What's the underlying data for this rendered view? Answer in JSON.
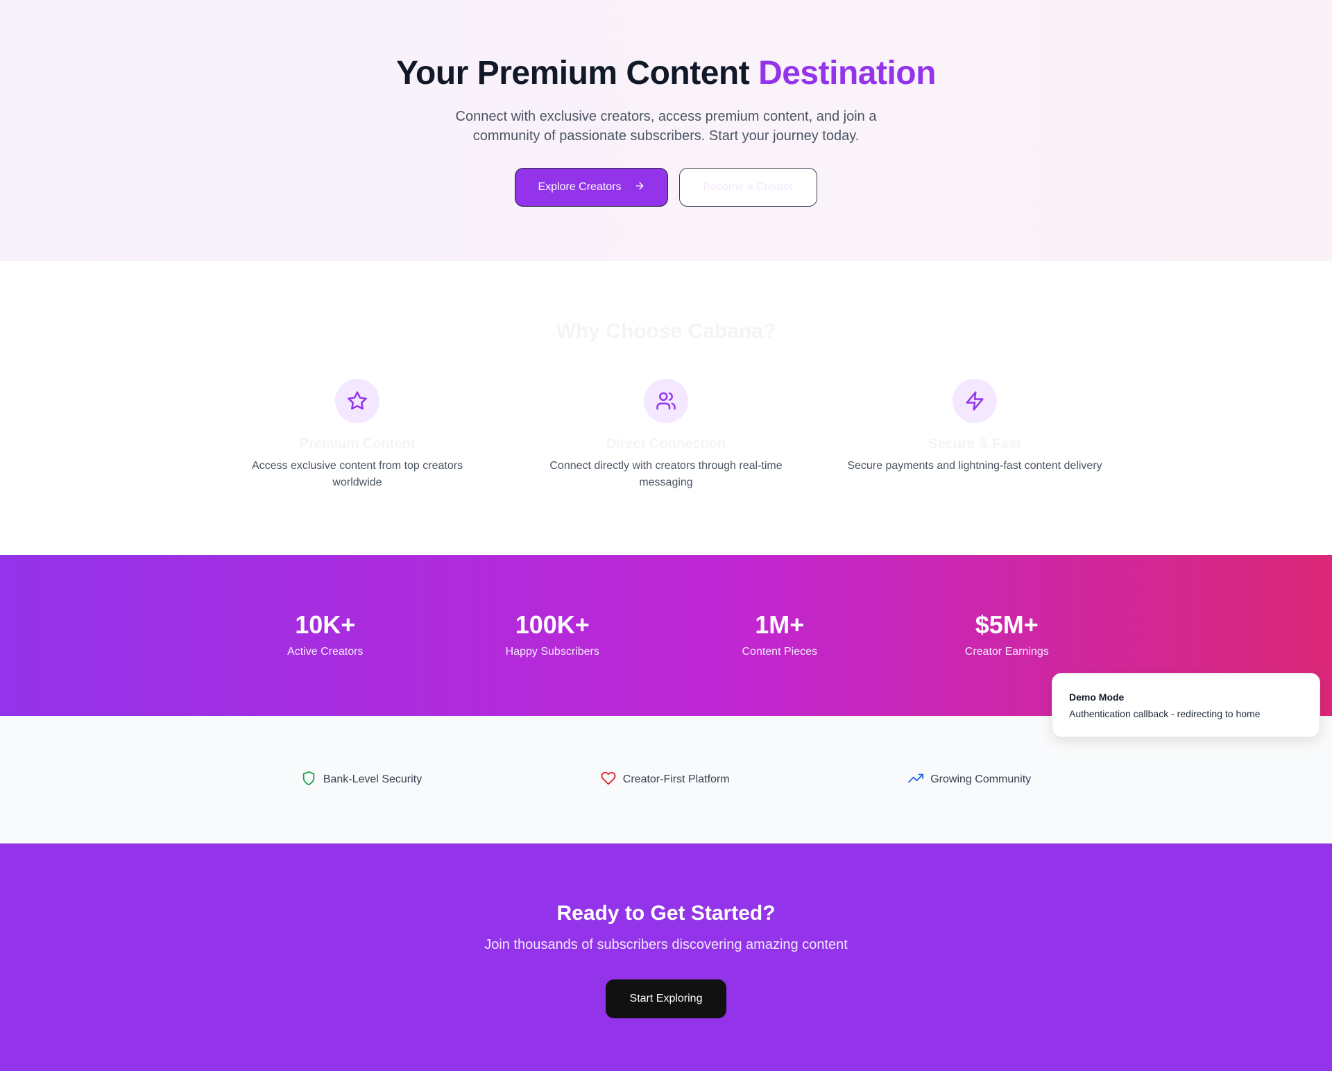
{
  "hero": {
    "title_main": "Your Premium Content ",
    "title_accent": "Destination",
    "subtitle": "Connect with exclusive creators, access premium content, and join a community of passionate subscribers. Start your journey today.",
    "primary_button": "Explore Creators",
    "secondary_button": "Become a Creator"
  },
  "features": {
    "heading": "Why Choose Cabana?",
    "items": [
      {
        "icon": "star-icon",
        "title": "Premium Content",
        "description": "Access exclusive content from top creators worldwide"
      },
      {
        "icon": "users-icon",
        "title": "Direct Connection",
        "description": "Connect directly with creators through real-time messaging"
      },
      {
        "icon": "lightning-icon",
        "title": "Secure & Fast",
        "description": "Secure payments and lightning-fast content delivery"
      }
    ]
  },
  "stats": [
    {
      "value": "10K+",
      "label": "Active Creators"
    },
    {
      "value": "100K+",
      "label": "Happy Subscribers"
    },
    {
      "value": "1M+",
      "label": "Content Pieces"
    },
    {
      "value": "$5M+",
      "label": "Creator Earnings"
    }
  ],
  "trust": [
    {
      "icon": "shield-icon",
      "label": "Bank-Level Security",
      "color": "#16a34a"
    },
    {
      "icon": "heart-icon",
      "label": "Creator-First Platform",
      "color": "#dc2626"
    },
    {
      "icon": "trending-up-icon",
      "label": "Growing Community",
      "color": "#2563eb"
    }
  ],
  "cta": {
    "heading": "Ready to Get Started?",
    "subtitle": "Join thousands of subscribers discovering amazing content",
    "button": "Start Exploring"
  },
  "toast": {
    "title": "Demo Mode",
    "description": "Authentication callback - redirecting to home"
  },
  "colors": {
    "accent": "#9333ea",
    "gradient_end": "#db2777"
  }
}
